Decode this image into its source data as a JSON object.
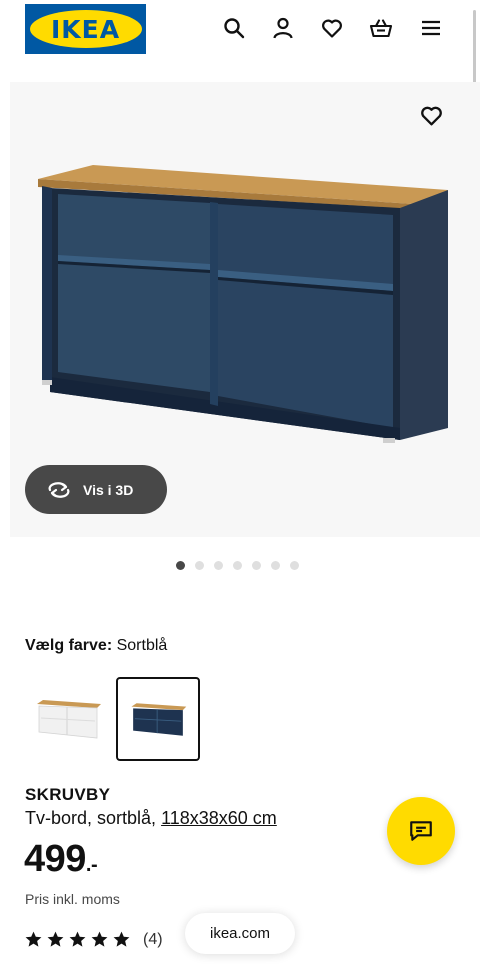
{
  "header": {
    "logo_text": "IKEA",
    "icons": [
      "search-icon",
      "user-icon",
      "heart-icon",
      "basket-icon",
      "menu-icon"
    ]
  },
  "gallery": {
    "view_3d_label": "Vis i 3D",
    "image_count": 7,
    "active_index": 0
  },
  "color_picker": {
    "label": "Vælg farve:",
    "value": "Sortblå",
    "options": [
      "white",
      "sortblå"
    ],
    "selected": "sortblå"
  },
  "product": {
    "name": "SKRUVBY",
    "description": "Tv-bord, sortblå,",
    "dimensions": "118x38x60 cm",
    "price": "499",
    "price_suffix": ".-",
    "price_note": "Pris inkl. moms",
    "rating_stars": 5,
    "review_count": "(4)"
  },
  "browser": {
    "url": "ikea.com"
  },
  "colors": {
    "brand_blue": "#0058a3",
    "brand_yellow": "#ffdb00",
    "dark_button": "#484848"
  }
}
